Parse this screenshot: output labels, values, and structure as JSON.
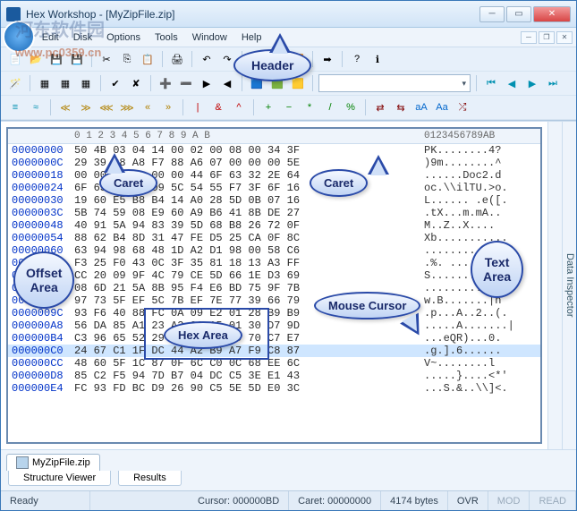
{
  "title": "Hex Workshop - [MyZipFile.zip]",
  "watermark": "河东软件园",
  "watermark_url": "www.pc0359.cn",
  "menus": [
    "File",
    "Edit",
    "Disk",
    "Options",
    "Tools",
    "Window",
    "Help"
  ],
  "file_tab": "MyZipFile.zip",
  "side_label": "Data Inspector",
  "bottom_tabs": [
    "Structure Viewer",
    "Results"
  ],
  "status": {
    "ready": "Ready",
    "cursor": "Cursor: 000000BD",
    "caret": "Caret: 00000000",
    "bytes": "4174 bytes",
    "ovr": "OVR",
    "mod": "MOD",
    "read": "READ"
  },
  "callouts": {
    "header": "Header",
    "caret1": "Caret",
    "caret2": "Caret",
    "offset": "Offset\nArea",
    "hex": "Hex Area",
    "text": "Text\nArea",
    "mouse": "Mouse Cursor"
  },
  "hexheader_off": "",
  "hexheader_hex": "  0  1  2  3  4  5  6  7  8  9  A  B ",
  "hexheader_asc": "0123456789AB",
  "rows": [
    {
      "o": "00000000",
      "h": "50 4B 03 04 14 00 02 00 08 00 34 3F",
      "a": "PK........4?"
    },
    {
      "o": "0000000C",
      "h": "29 39 D8 A8 F7 88 A6 07 00 00 00 5E",
      "a": ")9m........^"
    },
    {
      "o": "00000018",
      "h": "00 00 09 00 00 00 44 6F 63 32 2E 64",
      "a": "......Doc2.d"
    },
    {
      "o": "00000024",
      "h": "6F 63 ED 5C 09 5C 54 55 F7 3F 6F 16",
      "a": "oc.\\\\ilTU.>o."
    },
    {
      "o": "00000030",
      "h": "19 60 E5 B8 B4 14 A0 28 5D 0B 07 16",
      "a": "L...... .e([."
    },
    {
      "o": "0000003C",
      "h": "5B 74 59 08 E9 60 A9 B6 41 8B DE 27",
      "a": ".tX...m.mA.."
    },
    {
      "o": "00000048",
      "h": "40 91 5A 94 83 39 5D 68 B8 26 72 0F",
      "a": "M..Z..X...."
    },
    {
      "o": "00000054",
      "h": "88 62 B4 8D 31 47 FE D5 25 CA 0F 8C",
      "a": "Xb..........."
    },
    {
      "o": "00000060",
      "h": "63 94 98 68 48 1D A2 D1 98 00 58 C6",
      "a": "............"
    },
    {
      "o": "00000069",
      "h": "F3 25 F0 43 0C 3F 35 81 18 13 A3 FF",
      "a": ".%. .........."
    },
    {
      "o": "00000078",
      "h": "CC 20 09 9F 4C 79 CE 5D 66 1E D3 69",
      "a": "S..........."
    },
    {
      "o": "00000084",
      "h": "08 6D 21 5A 8B 95 F4 E6 BD 75 9F 7B",
      "a": "............s"
    },
    {
      "o": "00000090",
      "h": "97 73 5F EF 5C 7B EF 7E 77 39 66 79",
      "a": "w.B.......|n"
    },
    {
      "o": "0000009C",
      "h": "93 F6 40 88 FC 0A 09 E2 01 28 B9 B9",
      "a": ".p...A..2..(."
    },
    {
      "o": "000000A8",
      "h": "56 DA 85 A1 23 A2 96 A5 01 30 D7 9D",
      "a": ".....A.......|"
    },
    {
      "o": "000000B4",
      "h": "C3 96 65 52 29 E1 A5 01 3D 70 C7 E7",
      "a": "...eQR)...0."
    },
    {
      "o": "000000C0",
      "h": "24 67 C1 1F DC 44 A2 B9 A7 F9 C8 87",
      "a": ".g.].6......"
    },
    {
      "o": "000000CC",
      "h": "48 60 5F 1C 87 0F 6C C0 0C 68 EE 6C",
      "a": "V~........l"
    },
    {
      "o": "000000D8",
      "h": "85 C2 F5 94 7D B7 04 DC C5 3E E1 43",
      "a": ".....}....<*'"
    },
    {
      "o": "000000E4",
      "h": "FC 93 FD BC D9 26 90 C5 5E 5D E0 3C",
      "a": "...S.&..\\\\]<."
    }
  ]
}
